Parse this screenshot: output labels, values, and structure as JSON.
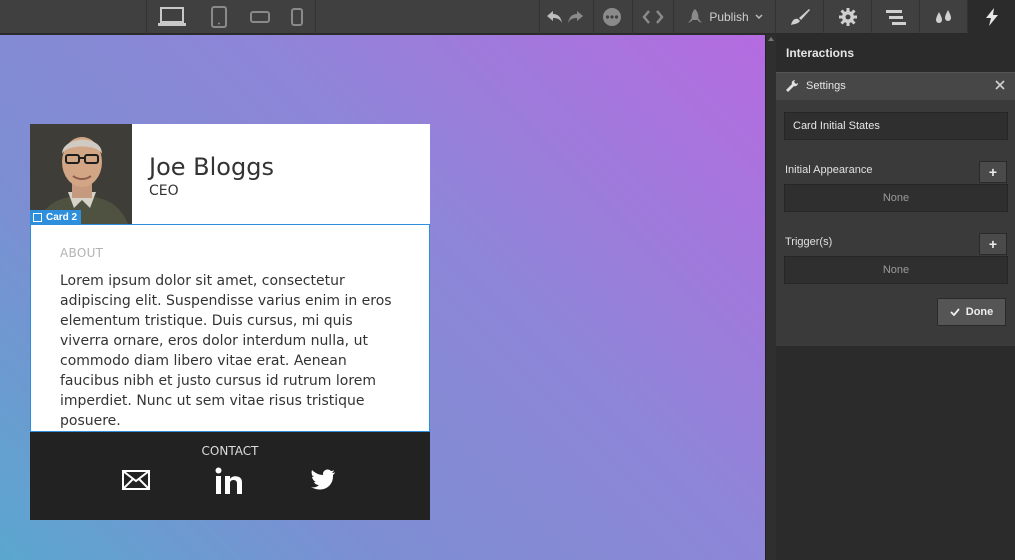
{
  "toolbar": {
    "devices": [
      {
        "name": "desktop-icon",
        "active": true
      },
      {
        "name": "tablet-icon",
        "active": false
      },
      {
        "name": "mobile-landscape-icon",
        "active": false
      },
      {
        "name": "mobile-portrait-icon",
        "active": false
      }
    ],
    "publish_label": "Publish"
  },
  "tabs": [
    {
      "name": "style-tab",
      "icon": "brush-icon"
    },
    {
      "name": "settings-tab",
      "icon": "gear-icon"
    },
    {
      "name": "navigator-tab",
      "icon": "layers-icon"
    },
    {
      "name": "swatches-tab",
      "icon": "drops-icon"
    },
    {
      "name": "interactions-tab",
      "icon": "lightning-icon",
      "active": true
    }
  ],
  "card": {
    "name": "Joe Bloggs",
    "role": "CEO",
    "selection_label": "Card 2",
    "about_heading": "ABOUT",
    "about_text": "Lorem ipsum dolor sit amet, consectetur adipiscing elit. Suspendisse varius enim in eros elementum tristique. Duis cursus, mi quis viverra ornare, eros dolor interdum nulla, ut commodo diam libero vitae erat. Aenean faucibus nibh et justo cursus id rutrum lorem imperdiet. Nunc ut sem vitae risus tristique posuere.",
    "contact_heading": "CONTACT",
    "social_icons": [
      "mail-icon",
      "linkedin-icon",
      "twitter-icon"
    ]
  },
  "panel": {
    "title": "Interactions",
    "settings_label": "Settings",
    "state_name": "Card Initial States",
    "initial_appearance_label": "Initial Appearance",
    "initial_appearance_value": "None",
    "triggers_label": "Trigger(s)",
    "triggers_value": "None",
    "done_label": "Done"
  }
}
